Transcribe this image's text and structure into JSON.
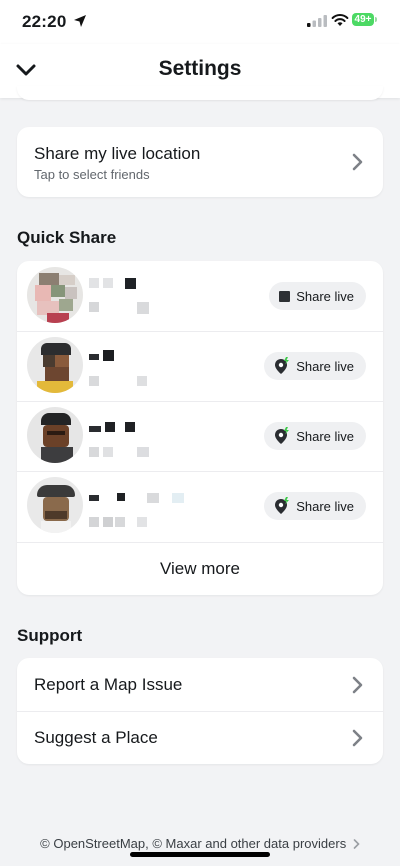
{
  "status_bar": {
    "time": "22:20",
    "battery": "49+"
  },
  "header": {
    "title": "Settings"
  },
  "live_location": {
    "title": "Share my live location",
    "subtitle": "Tap to select friends"
  },
  "quick_share": {
    "heading": "Quick Share",
    "friends": [
      {
        "share_label": "Share live",
        "icon": "stop-square-icon"
      },
      {
        "share_label": "Share live",
        "icon": "location-pin-icon"
      },
      {
        "share_label": "Share live",
        "icon": "location-pin-icon"
      },
      {
        "share_label": "Share live",
        "icon": "location-pin-icon"
      }
    ],
    "view_more": "View more"
  },
  "support": {
    "heading": "Support",
    "items": [
      {
        "label": "Report a Map Issue"
      },
      {
        "label": "Suggest a Place"
      }
    ]
  },
  "footer": {
    "attribution": "© OpenStreetMap, © Maxar and other data providers"
  },
  "colors": {
    "background": "#f2f3f5",
    "card": "#ffffff",
    "battery_green": "#4cd964",
    "share_button_bg": "#eff0f2",
    "pin_accent": "#3ec94a"
  }
}
